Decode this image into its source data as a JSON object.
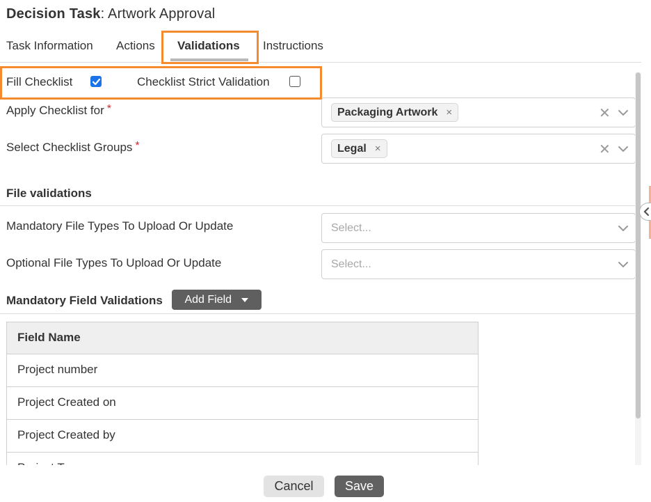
{
  "header": {
    "title_strong": "Decision Task",
    "title_rest": ": Artwork Approval"
  },
  "tabs": [
    {
      "label": "Task Information",
      "active": false
    },
    {
      "label": "Actions",
      "active": false
    },
    {
      "label": "Validations",
      "active": true
    },
    {
      "label": "Instructions",
      "active": false
    }
  ],
  "checklist": {
    "fill_label": "Fill Checklist",
    "fill_checked": true,
    "strict_label": "Checklist Strict Validation",
    "strict_checked": false
  },
  "apply_checklist": {
    "label": "Apply Checklist for",
    "required_mark": "*",
    "chip": "Packaging Artwork"
  },
  "checklist_groups": {
    "label": "Select Checklist Groups",
    "required_mark": "*",
    "chip": "Legal"
  },
  "file_validations": {
    "title": "File validations",
    "mandatory_label": "Mandatory File Types To Upload Or Update",
    "mandatory_placeholder": "Select...",
    "optional_label": "Optional File Types To Upload Or Update",
    "optional_placeholder": "Select..."
  },
  "field_validations": {
    "title": "Mandatory Field Validations",
    "add_button": "Add Field",
    "table_header": "Field Name",
    "rows": [
      "Project number",
      "Project Created on",
      "Project Created by",
      "Project Type"
    ]
  },
  "footer": {
    "cancel": "Cancel",
    "save": "Save"
  },
  "colors": {
    "highlight": "#f58a2e",
    "checkbox_checked": "#1a73e8",
    "required": "#d9262e"
  },
  "icons": {
    "chip_remove": "×",
    "clear": "✕",
    "dropdown": "chevron-down-icon",
    "side_toggle": "chevron-left-icon"
  }
}
